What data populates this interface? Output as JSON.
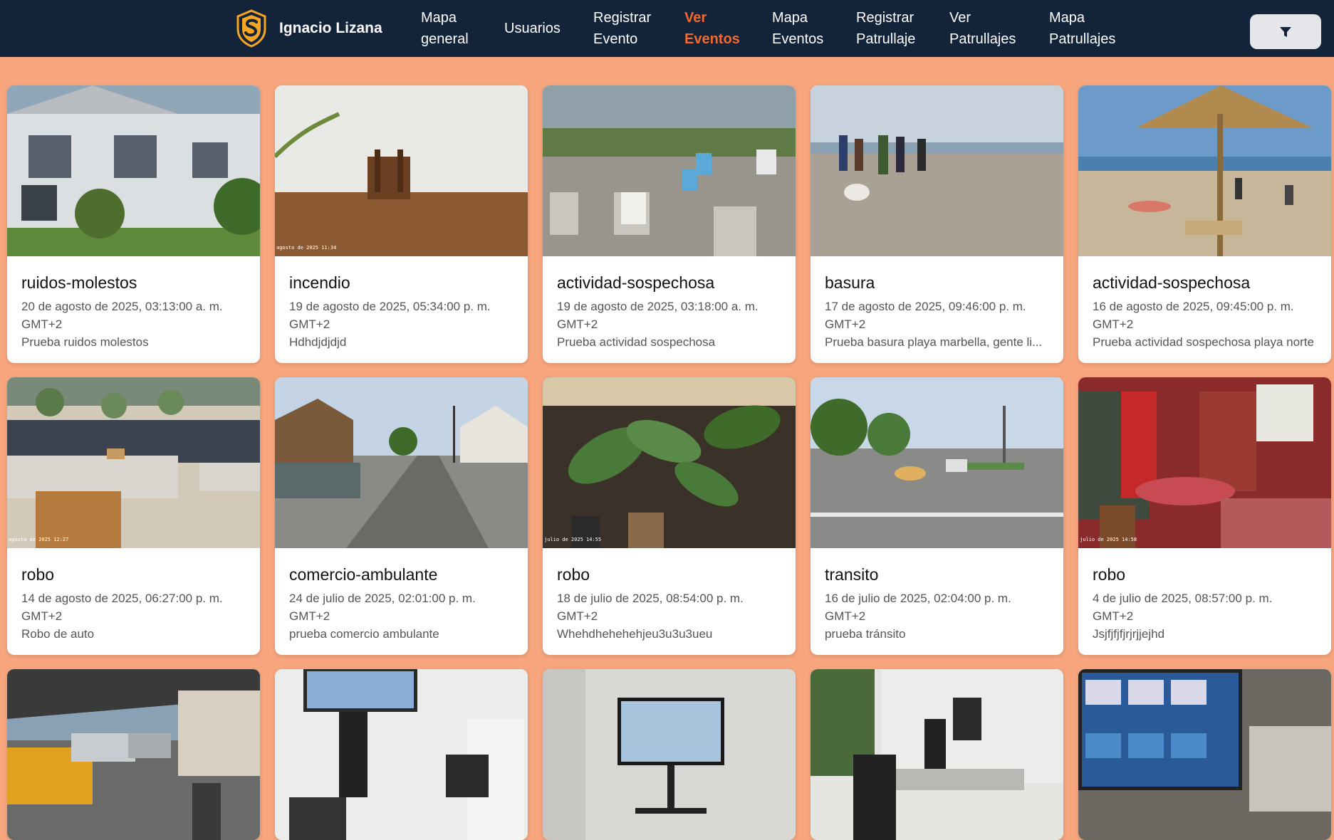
{
  "navbar": {
    "brand_name": "Ignacio Lizana",
    "links": [
      {
        "line1": "Mapa",
        "line2": "general",
        "active": false
      },
      {
        "line1": "Usuarios",
        "line2": "",
        "active": false
      },
      {
        "line1": "Registrar",
        "line2": "Evento",
        "active": false
      },
      {
        "line1": "Ver",
        "line2": "Eventos",
        "active": true
      },
      {
        "line1": "Mapa",
        "line2": "Eventos",
        "active": false
      },
      {
        "line1": "Registrar",
        "line2": "Patrullaje",
        "active": false
      },
      {
        "line1": "Ver",
        "line2": "Patrullajes",
        "active": false
      },
      {
        "line1": "Mapa",
        "line2": "Patrullajes",
        "active": false
      }
    ],
    "filter_icon": "filter-icon"
  },
  "colors": {
    "navbar_bg": "#13233a",
    "page_bg": "#f6a57c",
    "active_link": "#f26a2e",
    "logo_orange": "#f5a623"
  },
  "events": [
    {
      "title": "ruidos-molestos",
      "date": "20 de agosto de 2025, 03:13:00 a. m.",
      "tz": "GMT+2",
      "desc": "Prueba ruidos molestos",
      "stamp": ""
    },
    {
      "title": "incendio",
      "date": "19 de agosto de 2025, 05:34:00 p. m.",
      "tz": "GMT+2",
      "desc": "Hdhdjdjdjd",
      "stamp": "agosto de 2025 11:34"
    },
    {
      "title": "actividad-sospechosa",
      "date": "19 de agosto de 2025, 03:18:00 a. m.",
      "tz": "GMT+2",
      "desc": "Prueba actividad sospechosa",
      "stamp": ""
    },
    {
      "title": "basura",
      "date": "17 de agosto de 2025, 09:46:00 p. m.",
      "tz": "GMT+2",
      "desc": "Prueba basura playa marbella, gente li...",
      "stamp": ""
    },
    {
      "title": "actividad-sospechosa",
      "date": "16 de agosto de 2025, 09:45:00 p. m.",
      "tz": "GMT+2",
      "desc": "Prueba actividad sospechosa playa norte",
      "stamp": ""
    },
    {
      "title": "robo",
      "date": "14 de agosto de 2025, 06:27:00 p. m.",
      "tz": "GMT+2",
      "desc": "Robo de auto",
      "stamp": "agosto de 2025 12:27"
    },
    {
      "title": "comercio-ambulante",
      "date": "24 de julio de 2025, 02:01:00 p. m.",
      "tz": "GMT+2",
      "desc": "prueba comercio ambulante",
      "stamp": ""
    },
    {
      "title": "robo",
      "date": "18 de julio de 2025, 08:54:00 p. m.",
      "tz": "GMT+2",
      "desc": "Whehdhehehehjeu3u3u3ueu",
      "stamp": "julio de 2025 14:55"
    },
    {
      "title": "transito",
      "date": "16 de julio de 2025, 02:04:00 p. m.",
      "tz": "GMT+2",
      "desc": "prueba tránsito",
      "stamp": ""
    },
    {
      "title": "robo",
      "date": "4 de julio de 2025, 08:57:00 p. m.",
      "tz": "GMT+2",
      "desc": "Jsjfjfjfjrjrjjejhd",
      "stamp": "julio de 2025 14:58"
    },
    {
      "title": "",
      "date": "",
      "tz": "",
      "desc": "",
      "stamp": ""
    },
    {
      "title": "",
      "date": "",
      "tz": "",
      "desc": "",
      "stamp": ""
    },
    {
      "title": "",
      "date": "",
      "tz": "",
      "desc": "",
      "stamp": ""
    },
    {
      "title": "",
      "date": "",
      "tz": "",
      "desc": "",
      "stamp": ""
    },
    {
      "title": "",
      "date": "",
      "tz": "",
      "desc": "",
      "stamp": ""
    }
  ],
  "photo_subjects": [
    "house-photo",
    "chair-table-photo",
    "beach-signs-photo",
    "beach-people-photo",
    "beach-umbrella-photo",
    "restaurant-photo",
    "street-photo",
    "plants-photo",
    "road-photo",
    "red-room-photo",
    "cars-street-photo",
    "office-screens-photo",
    "monitor-photo",
    "office-desk-photo",
    "screen-closeup-photo"
  ]
}
